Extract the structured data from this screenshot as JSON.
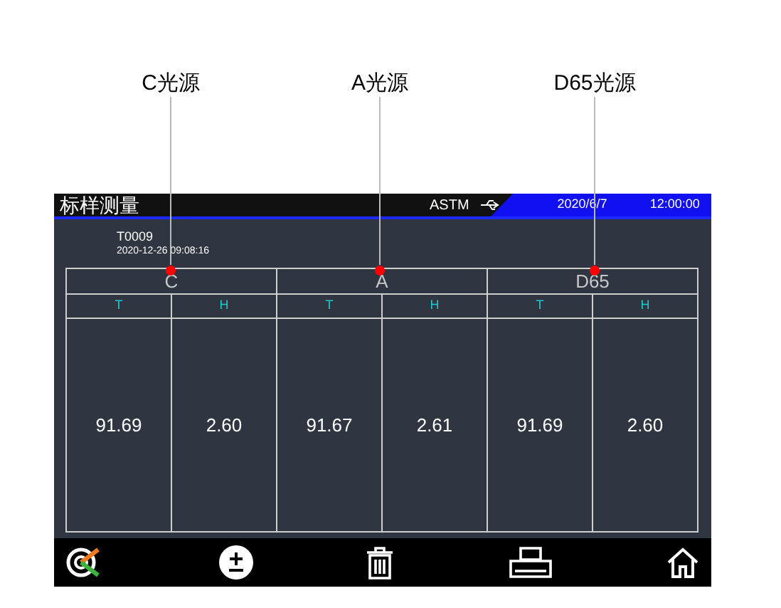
{
  "callouts": [
    "C光源",
    "A光源",
    "D65光源"
  ],
  "header": {
    "title": "标样测量",
    "standard": "ASTM",
    "date": "2020/6/7",
    "time": "12:00:00"
  },
  "sample": {
    "name": "T0009",
    "timestamp": "2020-12-26 09:08:16"
  },
  "table": {
    "groups": [
      {
        "illuminant": "C",
        "columns": [
          "T",
          "H"
        ],
        "values": [
          "91.69",
          "2.60"
        ]
      },
      {
        "illuminant": "A",
        "columns": [
          "T",
          "H"
        ],
        "values": [
          "91.67",
          "2.61"
        ]
      },
      {
        "illuminant": "D65",
        "columns": [
          "T",
          "H"
        ],
        "values": [
          "91.69",
          "2.60"
        ]
      }
    ]
  }
}
